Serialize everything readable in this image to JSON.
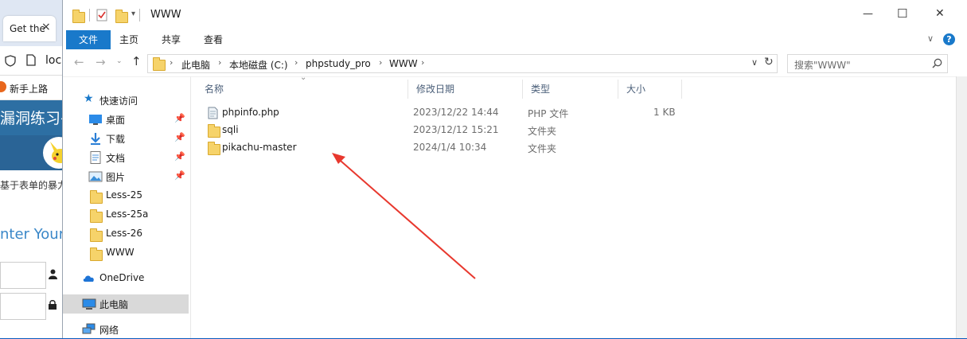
{
  "browser": {
    "tab_title": "Get the",
    "tab_close": "×",
    "url_prefix": "loc",
    "bookmark": "新手上路",
    "page_title": "漏洞练习平",
    "subtext": "基于表单的暴力",
    "enter_text": "nter Your"
  },
  "explorer": {
    "title": "WWW",
    "window_controls": {
      "minimize": "—",
      "maximize": "☐",
      "close": "✕"
    },
    "ribbon_tabs": [
      "文件",
      "主页",
      "共享",
      "查看"
    ],
    "breadcrumb": [
      "此电脑",
      "本地磁盘 (C:)",
      "phpstudy_pro",
      "WWW"
    ],
    "search_placeholder": "搜索\"WWW\"",
    "columns": {
      "name": "名称",
      "modified": "修改日期",
      "type": "类型",
      "size": "大小"
    },
    "nav": {
      "quick_access": "快速访问",
      "items": [
        {
          "label": "桌面",
          "icon": "desktop-icon",
          "pinned": true
        },
        {
          "label": "下载",
          "icon": "download-icon",
          "pinned": true
        },
        {
          "label": "文档",
          "icon": "document-icon",
          "pinned": true
        },
        {
          "label": "图片",
          "icon": "picture-icon",
          "pinned": true
        },
        {
          "label": "Less-25",
          "icon": "folder-icon",
          "pinned": false
        },
        {
          "label": "Less-25a",
          "icon": "folder-icon",
          "pinned": false
        },
        {
          "label": "Less-26",
          "icon": "folder-icon",
          "pinned": false
        },
        {
          "label": "WWW",
          "icon": "folder-icon",
          "pinned": false
        }
      ],
      "onedrive": "OneDrive",
      "this_pc": "此电脑",
      "network": "网络"
    },
    "files": [
      {
        "name": "phpinfo.php",
        "modified": "2023/12/22 14:44",
        "type": "PHP 文件",
        "size": "1 KB",
        "icon": "php-file-icon"
      },
      {
        "name": "sqli",
        "modified": "2023/12/12 15:21",
        "type": "文件夹",
        "size": "",
        "icon": "folder-icon"
      },
      {
        "name": "pikachu-master",
        "modified": "2024/1/4 10:34",
        "type": "文件夹",
        "size": "",
        "icon": "folder-icon"
      }
    ]
  },
  "colors": {
    "accent": "#1979ca",
    "annotation_arrow": "#e8382e",
    "folder": "#f6d36a"
  }
}
